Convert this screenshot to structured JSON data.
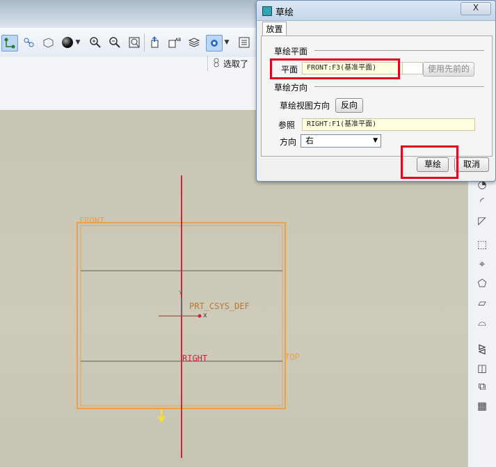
{
  "toolbar": {
    "select_label": "选取了",
    "icons": [
      "sketch-tool-icon",
      "plane-network-icon",
      "layer-icon",
      "shading-sphere-icon",
      "zoom-in-icon",
      "zoom-out-icon",
      "refit-icon",
      "datum-display-icon",
      "annotation-icon",
      "layers-icon",
      "spin-center-icon"
    ]
  },
  "dialog": {
    "title": "草绘",
    "close": "X",
    "tab": "放置",
    "sketch_plane_section": "草绘平面",
    "plane_label": "平面",
    "plane_value": "FRONT:F3(基准平面)",
    "use_previous_button": "使用先前的",
    "orientation_section": "草绘方向",
    "view_direction_label": "草绘视图方向",
    "flip_button": "反向",
    "reference_label": "参照",
    "reference_value": "RIGHT:F1(基准平面)",
    "direction_label": "方向",
    "direction_value": "右",
    "sketch_button": "草绘",
    "cancel_button": "取消"
  },
  "canvas": {
    "front_label": "FRONT",
    "top_label": "TOP",
    "right_label": "RIGHT",
    "csys_label": "PRT_CSYS_DEF",
    "x_axis": "X",
    "y_axis": "Y"
  },
  "colors": {
    "highlight_red": "#e0001b",
    "datum_orange": "#e8a34a",
    "axis_red": "#d8203a"
  }
}
